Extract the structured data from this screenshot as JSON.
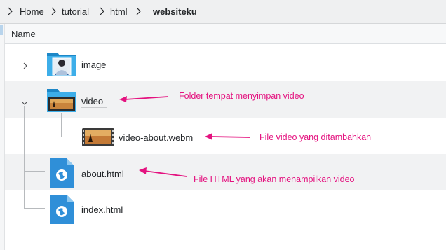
{
  "breadcrumb": {
    "items": [
      "Home",
      "tutorial",
      "html",
      "websiteku"
    ]
  },
  "column_header": {
    "name_label": "Name"
  },
  "rows": [
    {
      "label": "image",
      "type": "folder",
      "expanded": false
    },
    {
      "label": "video",
      "type": "folder",
      "expanded": true
    },
    {
      "label": "video-about.webm",
      "type": "video"
    },
    {
      "label": "about.html",
      "type": "html"
    },
    {
      "label": "index.html",
      "type": "html"
    }
  ],
  "annotations": [
    {
      "text": "Folder tempat menyimpan video"
    },
    {
      "text": "File video yang ditambahkan"
    },
    {
      "text": "File HTML yang akan menampilkan video"
    }
  ],
  "colors": {
    "annotation": "#e4127f",
    "folder": "#3daee9",
    "html_icon": "#2f8fd8"
  },
  "icons": {
    "home": "home-icon",
    "separator": "chevron-right-icon",
    "collapsed": "chevron-right-icon",
    "expanded": "chevron-down-icon"
  }
}
